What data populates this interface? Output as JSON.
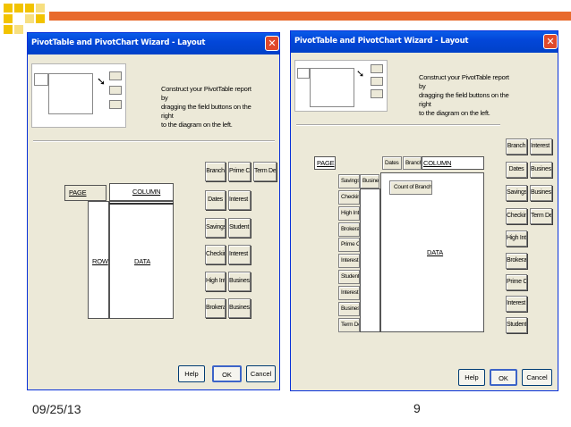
{
  "slide": {
    "date": "09/25/13",
    "page_number": "9",
    "accent_color": "#E86A2C",
    "deco_square_color": "#F2C300"
  },
  "dialog_left": {
    "title": "PivotTable and PivotChart Wizard - Layout",
    "instructions": [
      "Construct your PivotTable report by",
      "dragging the field buttons on the right",
      "to the diagram on the left."
    ],
    "areas": {
      "page": "PAGE",
      "column": "COLUMN",
      "row": "ROW",
      "data": "DATA"
    },
    "fields": [
      [
        "Branch",
        "Prime Che",
        "Term Dep"
      ],
      [
        "Dates",
        "Interest S"
      ],
      [
        "Savings",
        "Student C"
      ],
      [
        "Checking",
        "Interest C"
      ],
      [
        "High Inter",
        "Business C"
      ],
      [
        "Brokerage",
        "Business S"
      ]
    ],
    "buttons": {
      "help": "Help",
      "ok": "OK",
      "cancel": "Cancel"
    }
  },
  "dialog_right": {
    "title": "PivotTable and PivotChart Wizard - Layout",
    "instructions": [
      "Construct your PivotTable report by",
      "dragging the field buttons on the right",
      "to the diagram on the left."
    ],
    "areas": {
      "page": "PAGE",
      "column": "COLUMN",
      "data": "DATA"
    },
    "column_fields": [
      "Dates",
      "Branch"
    ],
    "row_fields": [
      "Savings",
      "Checking",
      "High Inter",
      "Brokerage",
      "Prime Che",
      "Interest S",
      "Student C",
      "Interest C",
      "Business C",
      "Term Dep"
    ],
    "row_second_field": "Business S",
    "data_field": "Count of Branch",
    "fields": [
      [
        "Branch",
        "Interest C"
      ],
      [
        "Dates",
        "Business C"
      ],
      [
        "Savings",
        "Business S"
      ],
      [
        "Checking",
        "Term Dep"
      ],
      [
        "High Inter"
      ],
      [
        "Brokerage"
      ],
      [
        "Prime Che"
      ],
      [
        "Interest S"
      ],
      [
        "Student C"
      ]
    ],
    "buttons": {
      "help": "Help",
      "ok": "OK",
      "cancel": "Cancel"
    }
  }
}
